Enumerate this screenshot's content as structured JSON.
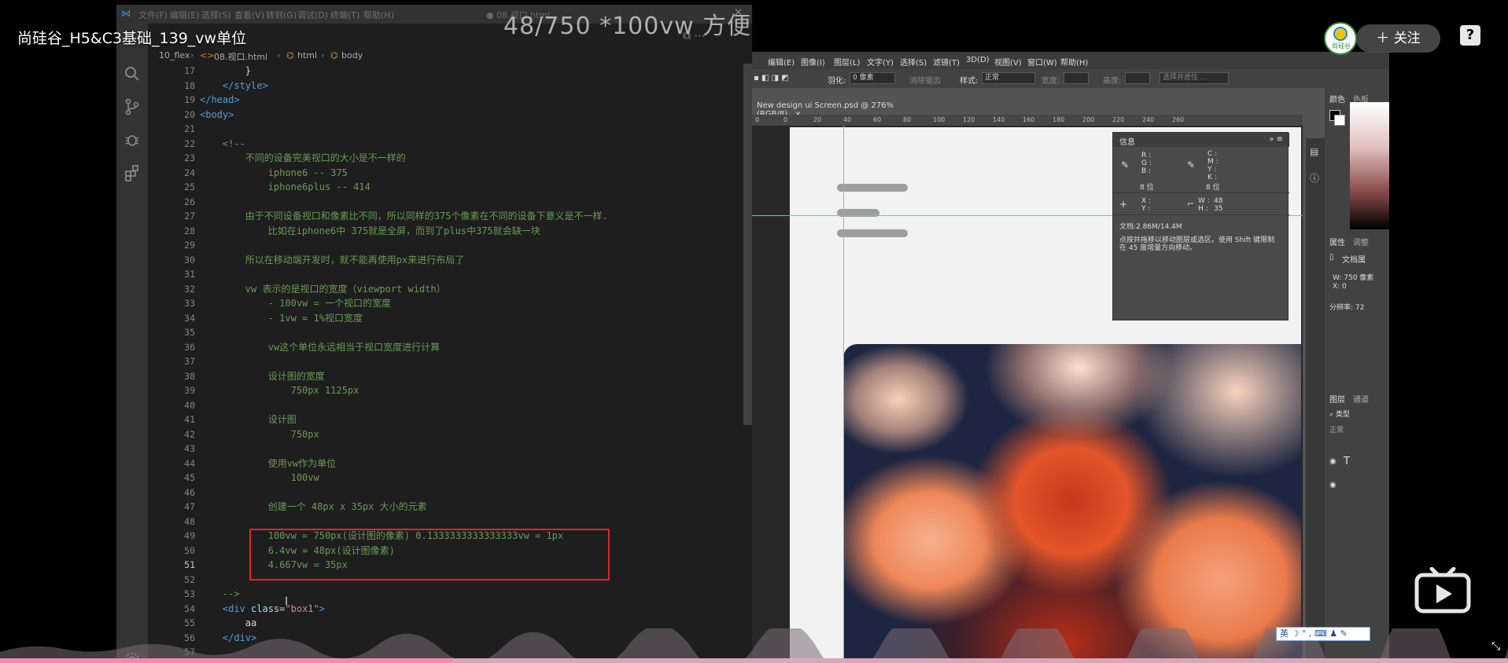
{
  "video": {
    "title": "尚硅谷_H5&C3基础_139_vw单位",
    "overlay_text": "48/750 *100vw 方便",
    "follow_label": "＋ 关注",
    "help_label": "?",
    "avatar_text": "尚硅谷"
  },
  "vscode": {
    "menu": [
      "文件(F)",
      "编辑(E)",
      "选择(S)",
      "查看(V)",
      "转到(G)",
      "调试(D)",
      "终端(T)",
      "帮助(H)"
    ],
    "window_title": "● 08.视口.html",
    "breadcrumb": [
      "10_flex",
      "08.视口.html",
      "html",
      "body"
    ],
    "lines": [
      {
        "n": "17",
        "text": "        }",
        "cls": "c-plain"
      },
      {
        "n": "18",
        "text": "    </style>",
        "cls": "c-tag"
      },
      {
        "n": "19",
        "text": "</head>",
        "cls": "c-tag"
      },
      {
        "n": "20",
        "text": "<body>",
        "cls": "c-tag"
      },
      {
        "n": "21",
        "text": "",
        "cls": "c-plain"
      },
      {
        "n": "22",
        "text": "    <!--",
        "cls": "c-cmt"
      },
      {
        "n": "23",
        "text": "        不同的设备完美视口的大小是不一样的",
        "cls": "c-cmt"
      },
      {
        "n": "24",
        "text": "            iphone6 -- 375",
        "cls": "c-cmt"
      },
      {
        "n": "25",
        "text": "            iphone6plus -- 414",
        "cls": "c-cmt"
      },
      {
        "n": "26",
        "text": "",
        "cls": "c-cmt"
      },
      {
        "n": "27",
        "text": "        由于不同设备视口和像素比不同，所以同样的375个像素在不同的设备下意义是不一样.",
        "cls": "c-cmt"
      },
      {
        "n": "28",
        "text": "            比如在iphone6中 375就是全屏，而到了plus中375就会缺一块",
        "cls": "c-cmt"
      },
      {
        "n": "29",
        "text": "",
        "cls": "c-cmt"
      },
      {
        "n": "30",
        "text": "        所以在移动端开发时，就不能再使用px来进行布局了",
        "cls": "c-cmt"
      },
      {
        "n": "31",
        "text": "",
        "cls": "c-cmt"
      },
      {
        "n": "32",
        "text": "        vw 表示的是视口的宽度（viewport width）",
        "cls": "c-cmt"
      },
      {
        "n": "33",
        "text": "            - 100vw = 一个视口的宽度",
        "cls": "c-cmt"
      },
      {
        "n": "34",
        "text": "            - 1vw = 1%视口宽度",
        "cls": "c-cmt"
      },
      {
        "n": "35",
        "text": "",
        "cls": "c-cmt"
      },
      {
        "n": "36",
        "text": "            vw这个单位永远相当于视口宽度进行计算",
        "cls": "c-cmt"
      },
      {
        "n": "37",
        "text": "",
        "cls": "c-cmt"
      },
      {
        "n": "38",
        "text": "            设计图的宽度",
        "cls": "c-cmt"
      },
      {
        "n": "39",
        "text": "                750px 1125px",
        "cls": "c-cmt"
      },
      {
        "n": "40",
        "text": "",
        "cls": "c-cmt"
      },
      {
        "n": "41",
        "text": "            设计图",
        "cls": "c-cmt"
      },
      {
        "n": "42",
        "text": "                750px",
        "cls": "c-cmt"
      },
      {
        "n": "43",
        "text": "",
        "cls": "c-cmt"
      },
      {
        "n": "44",
        "text": "            使用vw作为单位",
        "cls": "c-cmt"
      },
      {
        "n": "45",
        "text": "                100vw",
        "cls": "c-cmt"
      },
      {
        "n": "46",
        "text": "",
        "cls": "c-cmt"
      },
      {
        "n": "47",
        "text": "            创建一个 48px x 35px 大小的元素",
        "cls": "c-cmt"
      },
      {
        "n": "48",
        "text": "",
        "cls": "c-cmt"
      },
      {
        "n": "49",
        "text": "            100vw = 750px(设计图的像素) 0.1333333333333333vw = 1px",
        "cls": "c-cmt"
      },
      {
        "n": "50",
        "text": "            6.4vw = 48px(设计图像素)",
        "cls": "c-cmt"
      },
      {
        "n": "51",
        "text": "            4.667vw = 35px",
        "cls": "c-cmt"
      },
      {
        "n": "52",
        "text": "",
        "cls": "c-cmt"
      },
      {
        "n": "53",
        "text": "    -->",
        "cls": "c-cmt"
      },
      {
        "n": "54",
        "text": "    <div class=\"box1\">",
        "cls": "c-tag"
      },
      {
        "n": "55",
        "text": "        aa",
        "cls": "c-plain"
      },
      {
        "n": "56",
        "text": "    </div>",
        "cls": "c-tag"
      },
      {
        "n": "57",
        "text": "",
        "cls": "c-plain"
      }
    ],
    "current_line": "51"
  },
  "photoshop": {
    "menu": [
      "编辑(E)",
      "图像(I)",
      "图层(L)",
      "文字(Y)",
      "选择(S)",
      "滤镜(T)",
      "3D(D)",
      "视图(V)",
      "窗口(W)",
      "帮助(H)"
    ],
    "options": {
      "feather_label": "羽化:",
      "feather_value": "0 像素",
      "antialias": "消除锯齿",
      "style_label": "样式:",
      "style_value": "正常",
      "width_label": "宽度:",
      "height_label": "高度:",
      "select_mask": "选择并遮住 ..."
    },
    "doc_tab": "New design ui Screen.psd @ 276%(RGB/8)",
    "ruler": [
      "0",
      "0",
      "20",
      "40",
      "60",
      "80",
      "100",
      "120",
      "140",
      "160",
      "180",
      "200",
      "220",
      "240",
      "260"
    ],
    "info_panel": {
      "title": "信息",
      "rgb": [
        "R :",
        "G :",
        "B :"
      ],
      "cmyk": [
        "C :",
        "M :",
        "Y :",
        "K :"
      ],
      "bit_left": "8 位",
      "bit_right": "8 位",
      "xy": [
        "X :",
        "Y :"
      ],
      "w_label": "W :",
      "w_value": "48",
      "h_label": "H :",
      "h_value": "35",
      "doc_size": "文档:2.86M/14.4M",
      "hint": "点按并拖移以移动图层或选区。使用 Shift 键限制在 45 度增量方向移动。"
    },
    "right_panel": {
      "color_tab": "颜色",
      "swatch_tab": "色板",
      "props_tab": "属性",
      "adjust_tab": "调整",
      "doc_props": "文档属",
      "w_text": "W: 750 像素",
      "x_text": "X: 0",
      "resolution": "分辨率: 72",
      "layers_tab": "图层",
      "channels_tab": "通道",
      "kind": "类型",
      "blend": "正常"
    }
  },
  "ime": {
    "text": "英 ☽ ° , ⌨ ♟ ✎"
  },
  "progress": {
    "fraction": 0.3
  }
}
